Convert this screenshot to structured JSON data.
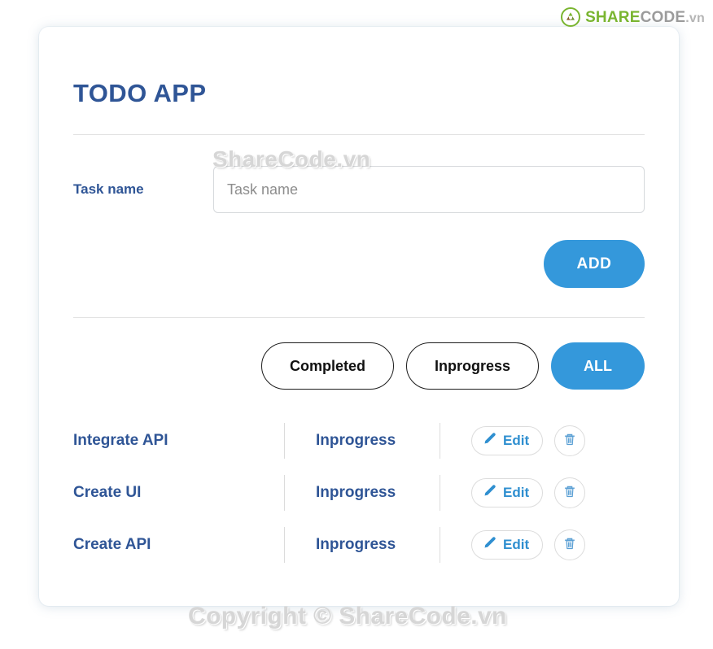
{
  "brand": {
    "mark_icon": "recycle-leaf-icon",
    "share": "SHARE",
    "code": "CODE",
    "vn": ".vn",
    "color_green": "#7ab530",
    "color_gray": "#9b9b9b"
  },
  "card": {
    "title": "TODO APP"
  },
  "form": {
    "label": "Task name",
    "input_value": "",
    "input_placeholder": "Task name",
    "add_label": "ADD"
  },
  "filters": [
    {
      "label": "Completed",
      "active": false
    },
    {
      "label": "Inprogress",
      "active": false
    },
    {
      "label": "ALL",
      "active": true
    }
  ],
  "tasks": [
    {
      "name": "Integrate API",
      "status": "Inprogress",
      "edit_label": "Edit",
      "edit_icon": "pencil-icon",
      "delete_icon": "trash-icon"
    },
    {
      "name": "Create UI",
      "status": "Inprogress",
      "edit_label": "Edit",
      "edit_icon": "pencil-icon",
      "delete_icon": "trash-icon"
    },
    {
      "name": "Create API",
      "status": "Inprogress",
      "edit_label": "Edit",
      "edit_icon": "pencil-icon",
      "delete_icon": "trash-icon"
    }
  ],
  "watermarks": {
    "middle": "ShareCode.vn",
    "bottom": "Copyright © ShareCode.vn"
  },
  "colors": {
    "accent_blue": "#3498db",
    "title_blue": "#2f5596",
    "link_blue": "#2f8fd0"
  }
}
